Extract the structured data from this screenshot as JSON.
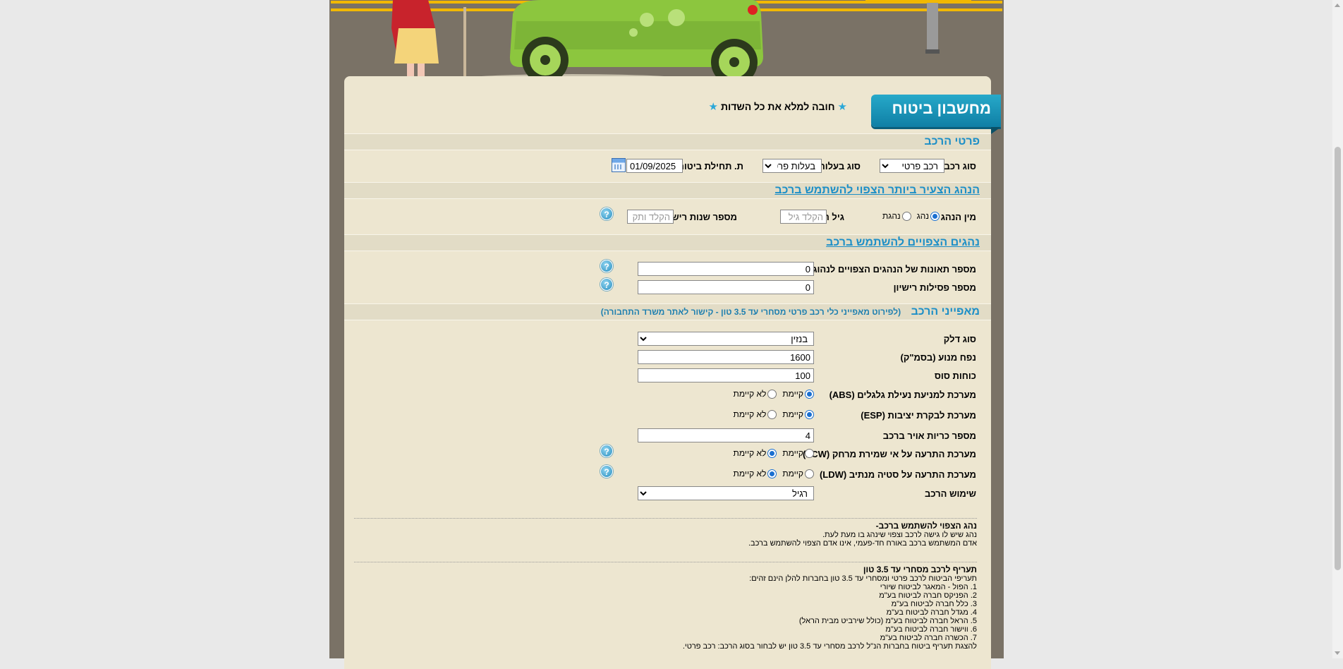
{
  "header": {
    "title": "מחשבון ביטוח",
    "mandatory_note": "חובה למלא את כל השדות"
  },
  "vehicle_details": {
    "section_title": "פרטי הרכב",
    "vehicle_type_label": "סוג רכב",
    "vehicle_type_value": "רכב פרטי",
    "ownership_label": "סוג בעלות",
    "ownership_value": "בעלות פרטית",
    "start_date_label": "ת. תחילת ביטוח",
    "start_date_value": "01/09/2025"
  },
  "young_driver": {
    "section_title": "הנהג הצעיר ביותר הצפוי להשתמש ברכב",
    "gender_label": "מין הנהג",
    "gender_male": "נהג",
    "gender_female": "נהגת",
    "age_label": "גיל הנהג",
    "age_placeholder": "הקלד גיל",
    "license_years_label": "מספר שנות רישוי",
    "license_years_placeholder": "הקלד ותק"
  },
  "drivers": {
    "section_title": "נהגים הצפויים להשתמש ברכב",
    "accidents_label": "מספר תאונות של הנהגים הצפויים לנהוג ברכב",
    "accidents_value": "0",
    "suspensions_label": "מספר פסילות רישיון",
    "suspensions_value": "0"
  },
  "features": {
    "section_title": "מאפייני הרכב",
    "section_note": "(לפירוט מאפייני כלי רכב פרטי מסחרי עד 3.5 טון - קישור לאתר משרד התחבורה)",
    "fuel_label": "סוג דלק",
    "fuel_value": "בנזין",
    "engine_label": "נפח מנוע (בסמ\"ק)",
    "engine_value": "1600",
    "hp_label": "כוחות סוס",
    "hp_value": "100",
    "abs_label": "מערכת למניעת נעילת גלגלים (ABS)",
    "esp_label": "מערכת לבקרת יציבות (ESP)",
    "airbags_label": "מספר כריות אויר ברכב",
    "airbags_value": "4",
    "fcw_label": "מערכת התרעה על אי שמירת מרחק (FCW)",
    "ldw_label": "מערכת התרעה על סטיה מנתיב (LDW)",
    "usage_label": "שימוש הרכב",
    "usage_value": "רגיל",
    "exists": "קיימת",
    "not_exists": "לא קיימת"
  },
  "info_driver": {
    "title": "נהג הצפוי להשתמש ברכב-",
    "line1": "נהג שיש לו גישה לרכב וצפוי שינהג בו מעת לעת.",
    "line2": "אדם המשתמש ברכב באורח חד-פעמי, אינו אדם הצפוי להשתמש ברכב."
  },
  "info_tariff": {
    "title": "תעריף לרכב מסחרי עד 3.5 טון",
    "intro": "תעריפי הביטוח לרכב פרטי ומסחרי עד 3.5 טון בחברות להלן הינם זהים:",
    "items": [
      "1. הפול - המאגר לביטוח שיורי",
      "2. הפניקס חברה לביטוח בע\"מ",
      "3. כלל חברה לביטוח בע\"מ",
      "4. מגדל חברה לביטוח בע\"מ",
      "5. הראל חברה לביטוח בע\"מ (כולל שירביט מבית הראל)",
      "6. ווישור חברה לביטוח בע\"מ",
      "7. הכשרה חברה לביטוח בע\"מ"
    ],
    "footer": "להצגת תעריף ביטוח בחברות הנ\"ל לרכב מסחרי עד 3.5 טון יש לבחור בסוג הרכב: רכב פרטי."
  },
  "colors": {
    "accent": "#1d8fc7",
    "panel": "#ede6d0",
    "frame": "#7a7266"
  }
}
